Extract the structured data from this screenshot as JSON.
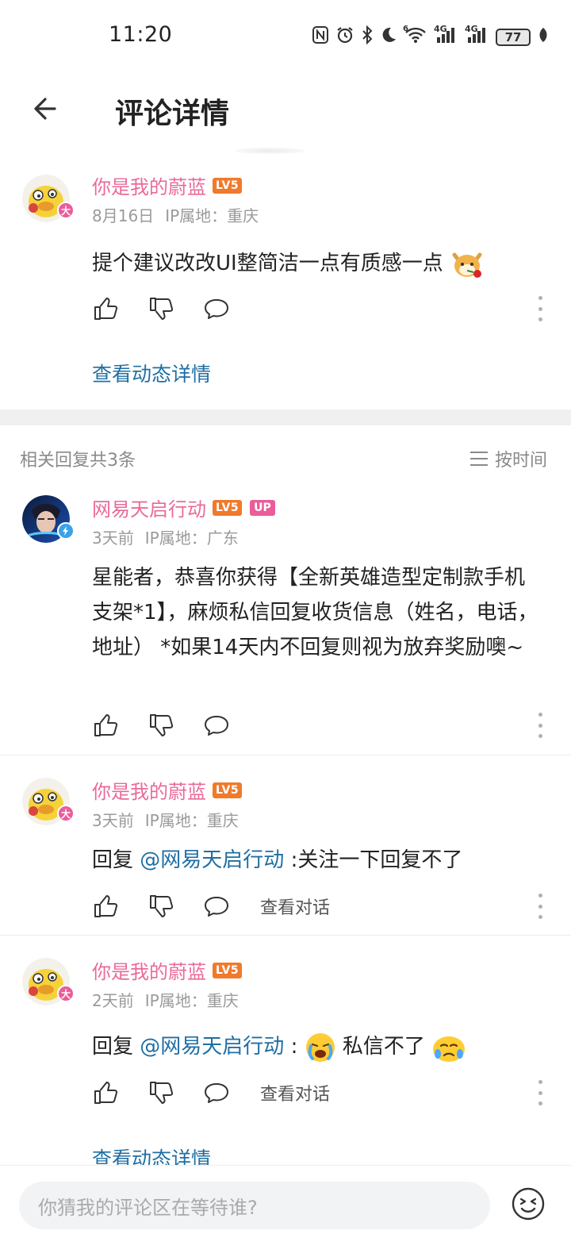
{
  "status_bar": {
    "time": "11:20",
    "battery": "77",
    "signal1": "4G",
    "signal2": "4G",
    "wifi_badge": "6"
  },
  "header": {
    "title": "评论详情"
  },
  "main_comment": {
    "username": "你是我的蔚蓝",
    "level": "LV5",
    "date": "8月16日",
    "ip": "IP属地：重庆",
    "text": "提个建议改改UI整简洁一点有质感一点",
    "view_link": "查看动态详情"
  },
  "replies_header": {
    "count_label": "相关回复共3条",
    "sort_label": "按时间"
  },
  "replies": [
    {
      "username": "网易天启行动",
      "level": "LV5",
      "up_badge": "UP",
      "date": "3天前",
      "ip": "IP属地：广东",
      "text": "星能者，恭喜你获得【全新英雄造型定制款手机支架*1】，麻烦私信回复收货信息（姓名，电话，地址） *如果14天内不回复则视为放弃奖励噢~"
    },
    {
      "username": "你是我的蔚蓝",
      "level": "LV5",
      "date": "3天前",
      "ip": "IP属地：重庆",
      "reply_prefix": "回复",
      "mention": "@网易天启行动",
      "text": ":关注一下回复不了",
      "view_convo": "查看对话"
    },
    {
      "username": "你是我的蔚蓝",
      "level": "LV5",
      "date": "2天前",
      "ip": "IP属地：重庆",
      "reply_prefix": "回复",
      "mention": "@网易天启行动",
      "text_before_emoji": ":",
      "text_after_emoji": "私信不了",
      "view_convo": "查看对话"
    }
  ],
  "bottom_link": "查看动态详情",
  "input": {
    "placeholder": "你猜我的评论区在等待谁?"
  },
  "colors": {
    "username_pink": "#e96a9a",
    "link_blue": "#1f6fa3",
    "level_orange": "#f07a2c"
  }
}
